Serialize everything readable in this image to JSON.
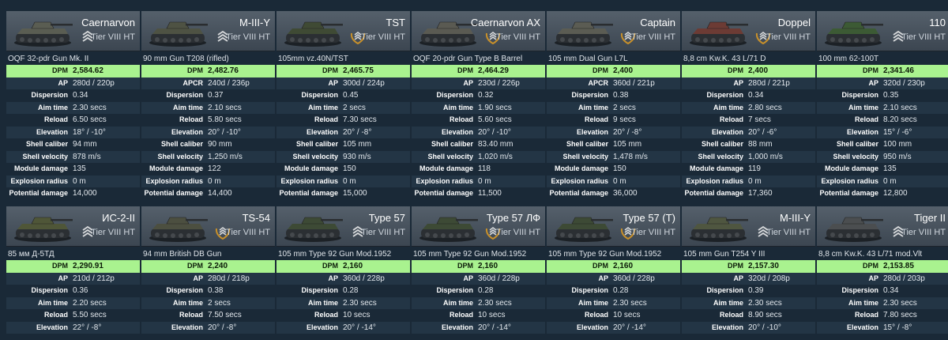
{
  "labels": {
    "dpm": "DPM",
    "ap": "AP",
    "apcr": "APCR",
    "dispersion": "Dispersion",
    "aim_time": "Aim time",
    "reload": "Reload",
    "elevation": "Elevation",
    "shell_caliber": "Shell caliber",
    "shell_velocity": "Shell velocity",
    "module_damage": "Module damage",
    "explosion_radius": "Explosion radius",
    "potential_damage": "Potential damage"
  },
  "tier": "Tier VIII HT",
  "row1": [
    {
      "name": "Caernarvon",
      "gun": "OQF 32-pdr Gun Mk. II",
      "dpm": "2,584.62",
      "pen_label": "AP",
      "pen": "280d / 220p",
      "dispersion": "0.34",
      "aim_time": "2.30 secs",
      "reload": "6.50 secs",
      "elevation": "18° / -10°",
      "shell_caliber": "94 mm",
      "shell_velocity": "878 m/s",
      "module_damage": "135",
      "explosion_radius": "0 m",
      "potential_damage": "14,000",
      "badge": "chevrons"
    },
    {
      "name": "M-III-Y",
      "gun": "90 mm Gun T208 (rifled)",
      "dpm": "2,482.76",
      "pen_label": "APCR",
      "pen": "240d / 236p",
      "dispersion": "0.37",
      "aim_time": "2.10 secs",
      "reload": "5.80 secs",
      "elevation": "20° / -10°",
      "shell_caliber": "90 mm",
      "shell_velocity": "1,250 m/s",
      "module_damage": "122",
      "explosion_radius": "0 m",
      "potential_damage": "14,400",
      "badge": "chevrons"
    },
    {
      "name": "TST",
      "gun": "105mm vz.40N/TST",
      "dpm": "2,465.75",
      "pen_label": "AP",
      "pen": "300d / 224p",
      "dispersion": "0.45",
      "aim_time": "2 secs",
      "reload": "7.30 secs",
      "elevation": "20° / -8°",
      "shell_caliber": "105 mm",
      "shell_velocity": "930 m/s",
      "module_damage": "150",
      "explosion_radius": "0 m",
      "potential_damage": "15,000",
      "badge": "wreath"
    },
    {
      "name": "Caernarvon AX",
      "gun": "OQF 20-pdr Gun Type B Barrel",
      "dpm": "2,464.29",
      "pen_label": "AP",
      "pen": "230d / 226p",
      "dispersion": "0.32",
      "aim_time": "1.90 secs",
      "reload": "5.60 secs",
      "elevation": "20° / -10°",
      "shell_caliber": "83.40 mm",
      "shell_velocity": "1,020 m/s",
      "module_damage": "118",
      "explosion_radius": "0 m",
      "potential_damage": "11,500",
      "badge": "wreath"
    },
    {
      "name": "Captain",
      "gun": "105 mm Dual Gun L7L",
      "dpm": "2,400",
      "pen_label": "APCR",
      "pen": "360d / 221p",
      "dispersion": "0.38",
      "aim_time": "2 secs",
      "reload": "9 secs",
      "elevation": "20° / -8°",
      "shell_caliber": "105 mm",
      "shell_velocity": "1,478 m/s",
      "module_damage": "150",
      "explosion_radius": "0 m",
      "potential_damage": "36,000",
      "badge": "wreath"
    },
    {
      "name": "Doppel",
      "gun": "8,8 cm Kw.K. 43 L/71 D",
      "dpm": "2,400",
      "pen_label": "AP",
      "pen": "280d / 221p",
      "dispersion": "0.34",
      "aim_time": "2.80 secs",
      "reload": "7 secs",
      "elevation": "20° / -6°",
      "shell_caliber": "88 mm",
      "shell_velocity": "1,000 m/s",
      "module_damage": "119",
      "explosion_radius": "0 m",
      "potential_damage": "17,360",
      "badge": "wreath"
    },
    {
      "name": "110",
      "gun": "100 mm 62-100T",
      "dpm": "2,341.46",
      "pen_label": "AP",
      "pen": "320d / 230p",
      "dispersion": "0.35",
      "aim_time": "2.10 secs",
      "reload": "8.20 secs",
      "elevation": "15° / -6°",
      "shell_caliber": "100 mm",
      "shell_velocity": "950 m/s",
      "module_damage": "135",
      "explosion_radius": "0 m",
      "potential_damage": "12,800",
      "badge": "chevrons"
    }
  ],
  "row2": [
    {
      "name": "ИС-2-II",
      "gun": "85 мм Д-5ТД",
      "dpm": "2,290.91",
      "pen_label": "AP",
      "pen": "210d / 212p",
      "dispersion": "0.36",
      "aim_time": "2.20 secs",
      "reload": "5.50 secs",
      "elevation": "22° / -8°",
      "badge": "chevrons"
    },
    {
      "name": "TS-54",
      "gun": "94 mm British DB Gun",
      "dpm": "2,240",
      "pen_label": "AP",
      "pen": "280d / 218p",
      "dispersion": "0.38",
      "aim_time": "2 secs",
      "reload": "7.50 secs",
      "elevation": "20° / -8°",
      "badge": "wreath"
    },
    {
      "name": "Type 57",
      "gun": "105 mm Type 92 Gun Mod.1952",
      "dpm": "2,160",
      "pen_label": "AP",
      "pen": "360d / 228p",
      "dispersion": "0.28",
      "aim_time": "2.30 secs",
      "reload": "10 secs",
      "elevation": "20° / -14°",
      "badge": "chevrons"
    },
    {
      "name": "Type 57 ЛФ",
      "gun": "105 mm Type 92 Gun Mod.1952",
      "dpm": "2,160",
      "pen_label": "AP",
      "pen": "360d / 228p",
      "dispersion": "0.28",
      "aim_time": "2.30 secs",
      "reload": "10 secs",
      "elevation": "20° / -14°",
      "badge": "wreath"
    },
    {
      "name": "Type 57 (T)",
      "gun": "105 mm Type 92 Gun Mod.1952",
      "dpm": "2,160",
      "pen_label": "AP",
      "pen": "360d / 228p",
      "dispersion": "0.28",
      "aim_time": "2.30 secs",
      "reload": "10 secs",
      "elevation": "20° / -14°",
      "badge": "wreath"
    },
    {
      "name": "M-III-Y",
      "gun": "105 mm Gun T254 Y III",
      "dpm": "2,157.30",
      "pen_label": "AP",
      "pen": "320d / 208p",
      "dispersion": "0.39",
      "aim_time": "2.30 secs",
      "reload": "8.90 secs",
      "elevation": "20° / -10°",
      "badge": "chevrons"
    },
    {
      "name": "Tiger II",
      "gun": "8,8 cm Kw.K. 43 L/71 mod.Vlt",
      "dpm": "2,153.85",
      "pen_label": "AP",
      "pen": "280d / 203p",
      "dispersion": "0.34",
      "aim_time": "2.30 secs",
      "reload": "7.80 secs",
      "elevation": "15° / -8°",
      "badge": "chevrons"
    }
  ],
  "colors": {
    "background": "#1a2937",
    "dpm_highlight": "#a9f28f",
    "header": "#4a545e"
  }
}
